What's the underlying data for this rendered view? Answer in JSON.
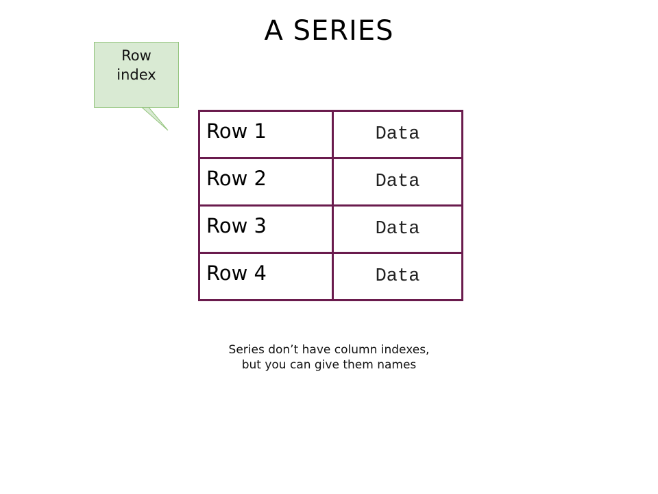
{
  "title": "A SERIES",
  "callout": {
    "text": "Row\nindex",
    "fill": "#d9ead3",
    "stroke": "#93c47d"
  },
  "table": {
    "border_color": "#6a1b4d",
    "rows": [
      {
        "index": "Row 1",
        "value": "Data"
      },
      {
        "index": "Row 2",
        "value": "Data"
      },
      {
        "index": "Row 3",
        "value": "Data"
      },
      {
        "index": "Row 4",
        "value": "Data"
      }
    ]
  },
  "note": "Series don’t have column indexes,\nbut you can give them names"
}
